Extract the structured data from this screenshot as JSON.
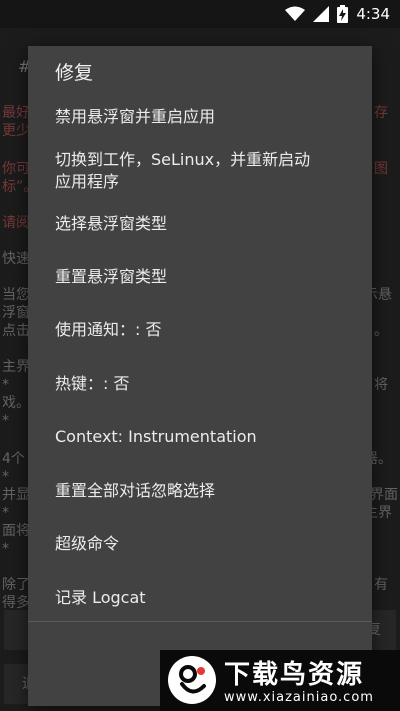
{
  "status_bar": {
    "time": "4:34"
  },
  "background": {
    "hash_fragment": "#",
    "lines": [
      {
        "text": "最好",
        "red": true
      },
      {
        "text": "更少",
        "red": true
      },
      {
        "text": "你可",
        "red": true
      },
      {
        "text": "标”。",
        "red": true
      },
      {
        "text": "请阅",
        "red": true
      },
      {
        "text": "快速",
        "red": false
      },
      {
        "text": "当您",
        "red": false
      },
      {
        "text": "浮窗",
        "red": false
      },
      {
        "text": "点击",
        "red": false
      },
      {
        "text": "主界",
        "red": false
      },
      {
        "text": "  *",
        "red": false
      },
      {
        "text": "戏。",
        "red": false
      },
      {
        "text": "  *",
        "red": false
      },
      {
        "text": "4个",
        "red": false
      },
      {
        "text": "  *",
        "red": false
      },
      {
        "text": "并显",
        "red": false
      },
      {
        "text": "  *",
        "red": false
      },
      {
        "text": "面将",
        "red": false
      },
      {
        "text": "  *",
        "red": false
      },
      {
        "text": "除了",
        "red": false
      },
      {
        "text": "得多",
        "red": false
      }
    ],
    "right_fragments": [
      {
        "text": "存",
        "red": true
      },
      {
        "text": "图",
        "red": true
      },
      {
        "text": "示悬",
        "red": false
      },
      {
        "text": "。",
        "red": false
      },
      {
        "text": "将",
        "red": false
      },
      {
        "text": "器。",
        "red": false
      },
      {
        "text": "界面",
        "red": false
      },
      {
        "text": "主界",
        "red": false
      },
      {
        "text": "有",
        "red": false
      }
    ],
    "bottom_buttons": {
      "left_label": "退",
      "right_label": "复"
    }
  },
  "menu": {
    "title": "修复",
    "items": [
      "禁用悬浮窗并重启应用",
      "切换到工作，SeLinux，并重新启动\n应用程序",
      "选择悬浮窗类型",
      "重置悬浮窗类型",
      "使用通知：: 否",
      "热键：: 否",
      "Context: Instrumentation",
      "重置全部对话忽略选择",
      "超级命令",
      "记录 Logcat"
    ]
  },
  "watermark": {
    "name": "下载鸟资源",
    "url": "www.xiazainiao.com"
  }
}
